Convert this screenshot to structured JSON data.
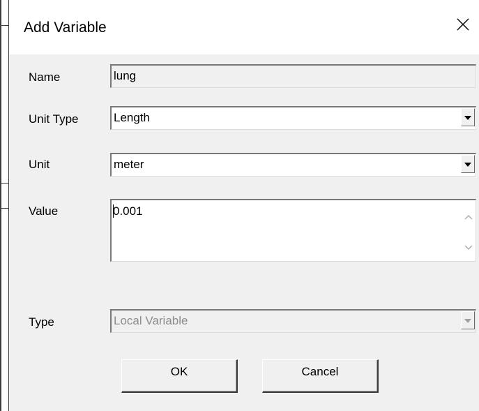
{
  "dialog": {
    "title": "Add Variable",
    "close_icon": "close-x-icon"
  },
  "form": {
    "name": {
      "label": "Name",
      "value": "lung"
    },
    "unit_type": {
      "label": "Unit Type",
      "value": "Length",
      "icon": "dropdown-arrow-icon"
    },
    "unit": {
      "label": "Unit",
      "value": "meter",
      "icon": "dropdown-arrow-icon"
    },
    "value": {
      "label": "Value",
      "value": "0.001",
      "scroll_up_icon": "chevron-up-icon",
      "scroll_down_icon": "chevron-down-icon"
    },
    "type": {
      "label": "Type",
      "value": "Local Variable",
      "icon": "dropdown-arrow-icon",
      "disabled": true
    }
  },
  "buttons": {
    "ok_label": "OK",
    "cancel_label": "Cancel"
  },
  "colors": {
    "dialog_bg": "#f0f0f0",
    "titlebar_bg": "#ffffff",
    "disabled_text": "#8c8c8c"
  }
}
